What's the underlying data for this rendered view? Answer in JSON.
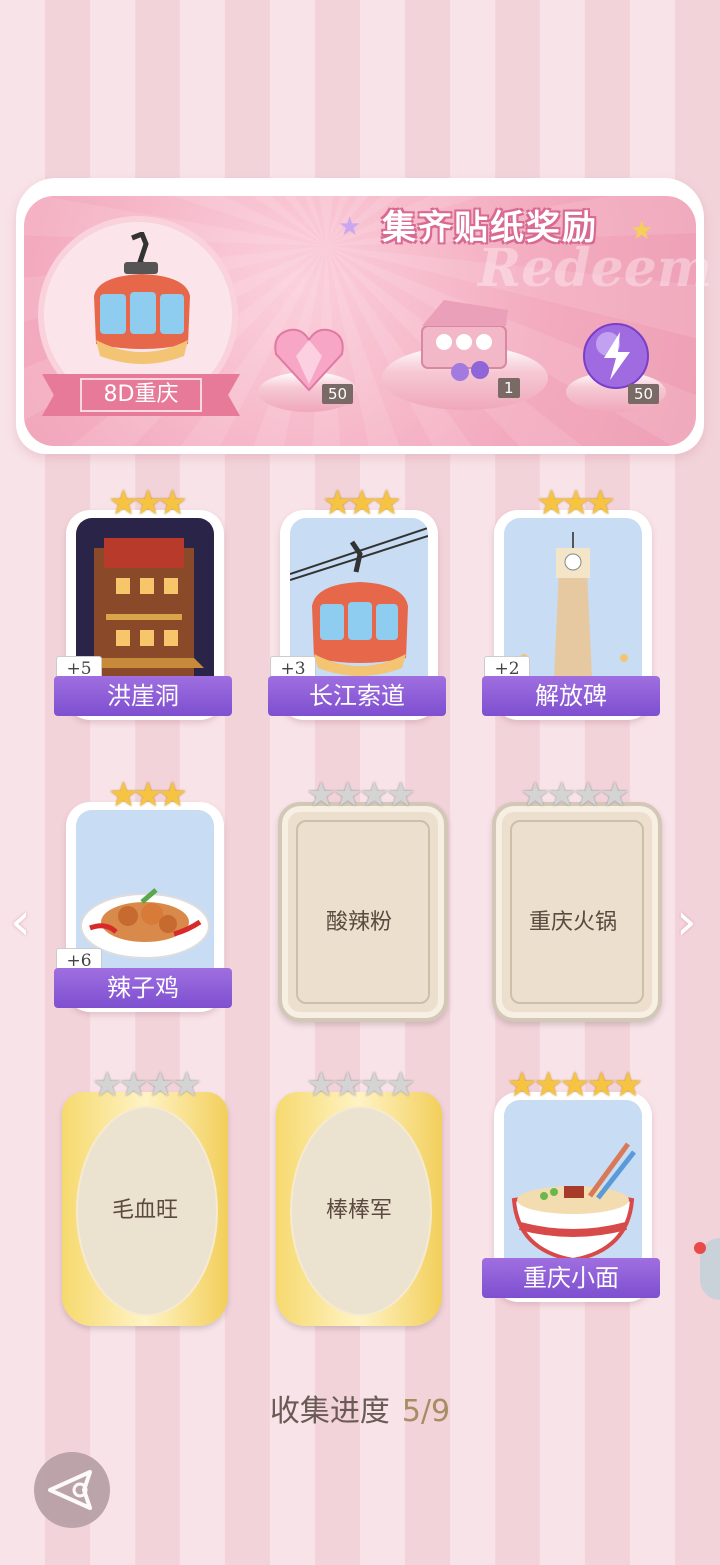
{
  "banner": {
    "title": "集齐贴纸奖励",
    "ghost_text": "Redeem",
    "city_name": "8D重庆",
    "rewards": [
      {
        "icon": "pink-heart-gem-icon",
        "count": "50"
      },
      {
        "icon": "gift-box-icon",
        "count": "1"
      },
      {
        "icon": "purple-energy-orb-icon",
        "count": "50"
      }
    ]
  },
  "stickers": [
    {
      "name": "洪崖洞",
      "state": "collected",
      "stars": 3,
      "max_stars": 3,
      "bonus": "+5",
      "icon": "hongyadong-building-icon"
    },
    {
      "name": "长江索道",
      "state": "collected",
      "stars": 3,
      "max_stars": 3,
      "bonus": "+3",
      "icon": "cable-car-icon"
    },
    {
      "name": "解放碑",
      "state": "collected",
      "stars": 3,
      "max_stars": 3,
      "bonus": "+2",
      "icon": "clock-tower-icon"
    },
    {
      "name": "辣子鸡",
      "state": "collected",
      "stars": 3,
      "max_stars": 3,
      "bonus": "+6",
      "icon": "spicy-chicken-dish-icon"
    },
    {
      "name": "酸辣粉",
      "state": "locked",
      "stars": 0,
      "max_stars": 4
    },
    {
      "name": "重庆火锅",
      "state": "locked",
      "stars": 0,
      "max_stars": 4
    },
    {
      "name": "毛血旺",
      "state": "locked-rare",
      "stars": 0,
      "max_stars": 4
    },
    {
      "name": "棒棒军",
      "state": "locked-rare",
      "stars": 0,
      "max_stars": 4
    },
    {
      "name": "重庆小面",
      "state": "collected",
      "stars": 5,
      "max_stars": 5,
      "icon": "noodle-bowl-icon"
    }
  ],
  "progress": {
    "label": "收集进度",
    "value": "5/9"
  },
  "colors": {
    "label_purple": "#8a5cd8",
    "star_gold": "#f6c441",
    "banner_pink": "#f3aabe",
    "title_stroke": "#d86a92"
  }
}
